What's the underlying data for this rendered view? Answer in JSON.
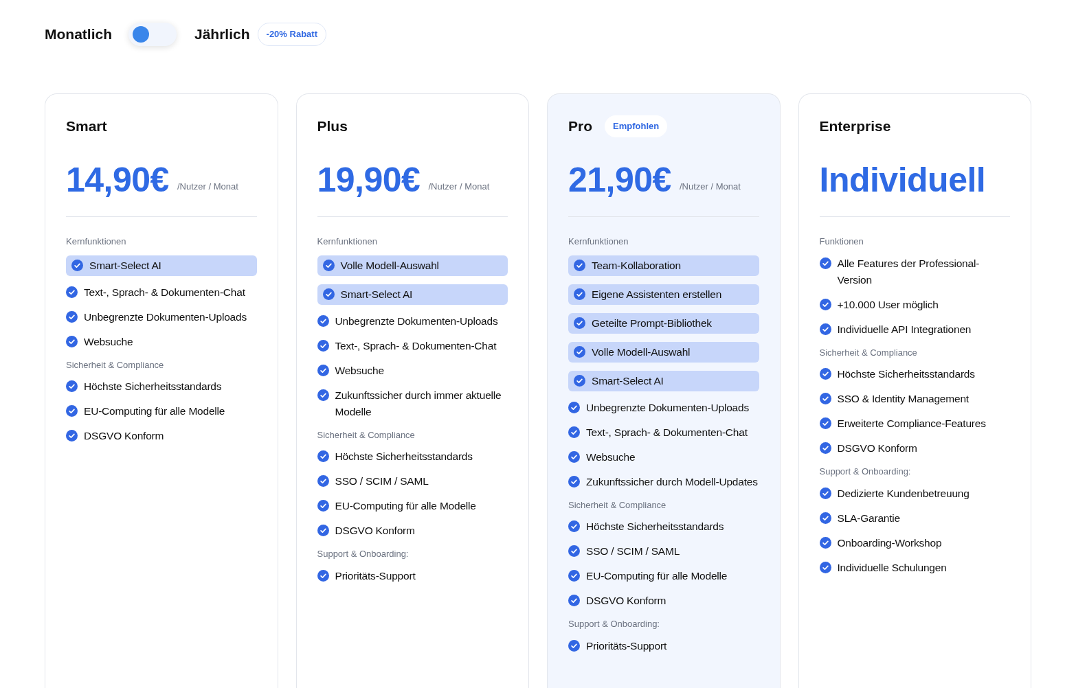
{
  "billing": {
    "monthly_label": "Monatlich",
    "yearly_label": "Jährlich",
    "yearly": false,
    "discount": "-20% Rabatt"
  },
  "plans": [
    {
      "name": "Smart",
      "recommended": false,
      "price": "14,90€",
      "unit": "/Nutzer / Monat",
      "sections": [
        {
          "heading": "Kernfunktionen",
          "features": [
            {
              "label": "Smart-Select AI",
              "highlighted": true
            },
            {
              "label": "Text-, Sprach- & Dokumenten-Chat",
              "highlighted": false
            },
            {
              "label": "Unbegrenzte Dokumenten-Uploads",
              "highlighted": false
            },
            {
              "label": "Websuche",
              "highlighted": false
            }
          ]
        },
        {
          "heading": "Sicherheit & Compliance",
          "features": [
            {
              "label": "Höchste Sicherheitsstandards",
              "highlighted": false
            },
            {
              "label": "EU-Computing für alle Modelle",
              "highlighted": false
            },
            {
              "label": "DSGVO Konform",
              "highlighted": false
            }
          ]
        }
      ]
    },
    {
      "name": "Plus",
      "recommended": false,
      "price": "19,90€",
      "unit": "/Nutzer / Monat",
      "sections": [
        {
          "heading": "Kernfunktionen",
          "features": [
            {
              "label": "Volle Modell-Auswahl",
              "highlighted": true
            },
            {
              "label": "Smart-Select AI",
              "highlighted": true
            },
            {
              "label": "Unbegrenzte Dokumenten-Uploads",
              "highlighted": false
            },
            {
              "label": "Text-, Sprach- & Dokumenten-Chat",
              "highlighted": false
            },
            {
              "label": "Websuche",
              "highlighted": false
            },
            {
              "label": "Zukunftssicher durch immer aktuelle Modelle",
              "highlighted": false
            }
          ]
        },
        {
          "heading": "Sicherheit & Compliance",
          "features": [
            {
              "label": "Höchste Sicherheitsstandards",
              "highlighted": false
            },
            {
              "label": "SSO / SCIM / SAML",
              "highlighted": false
            },
            {
              "label": "EU-Computing für alle Modelle",
              "highlighted": false
            },
            {
              "label": "DSGVO Konform",
              "highlighted": false
            }
          ]
        },
        {
          "heading": "Support & Onboarding:",
          "features": [
            {
              "label": "Prioritäts-Support",
              "highlighted": false
            }
          ]
        }
      ]
    },
    {
      "name": "Pro",
      "recommended": true,
      "badge": "Empfohlen",
      "price": "21,90€",
      "unit": "/Nutzer / Monat",
      "sections": [
        {
          "heading": "Kernfunktionen",
          "features": [
            {
              "label": "Team-Kollaboration",
              "highlighted": true
            },
            {
              "label": "Eigene Assistenten erstellen",
              "highlighted": true
            },
            {
              "label": "Geteilte Prompt-Bibliothek",
              "highlighted": true
            },
            {
              "label": "Volle Modell-Auswahl",
              "highlighted": true
            },
            {
              "label": "Smart-Select AI",
              "highlighted": true
            },
            {
              "label": "Unbegrenzte Dokumenten-Uploads",
              "highlighted": false
            },
            {
              "label": "Text-, Sprach- & Dokumenten-Chat",
              "highlighted": false
            },
            {
              "label": "Websuche",
              "highlighted": false
            },
            {
              "label": "Zukunftssicher durch Modell-Updates",
              "highlighted": false
            }
          ]
        },
        {
          "heading": "Sicherheit & Compliance",
          "features": [
            {
              "label": "Höchste Sicherheitsstandards",
              "highlighted": false
            },
            {
              "label": "SSO / SCIM / SAML",
              "highlighted": false
            },
            {
              "label": "EU-Computing für alle Modelle",
              "highlighted": false
            },
            {
              "label": "DSGVO Konform",
              "highlighted": false
            }
          ]
        },
        {
          "heading": "Support & Onboarding:",
          "features": [
            {
              "label": "Prioritäts-Support",
              "highlighted": false
            }
          ]
        }
      ]
    },
    {
      "name": "Enterprise",
      "recommended": false,
      "price": "Individuell",
      "sections": [
        {
          "heading": "Funktionen",
          "features": [
            {
              "label": "Alle Features der Professional-Version",
              "highlighted": false
            },
            {
              "label": "+10.000 User möglich",
              "highlighted": false
            },
            {
              "label": "Individuelle API Integrationen",
              "highlighted": false
            }
          ]
        },
        {
          "heading": "Sicherheit & Compliance",
          "features": [
            {
              "label": "Höchste Sicherheitsstandards",
              "highlighted": false
            },
            {
              "label": "SSO & Identity Management",
              "highlighted": false
            },
            {
              "label": "Erweiterte Compliance-Features",
              "highlighted": false
            },
            {
              "label": "DSGVO Konform",
              "highlighted": false
            }
          ]
        },
        {
          "heading": "Support & Onboarding:",
          "features": [
            {
              "label": "Dedizierte Kundenbetreuung",
              "highlighted": false
            },
            {
              "label": "SLA-Garantie",
              "highlighted": false
            },
            {
              "label": "Onboarding-Workshop",
              "highlighted": false
            },
            {
              "label": "Individuelle Schulungen",
              "highlighted": false
            }
          ]
        }
      ]
    }
  ]
}
